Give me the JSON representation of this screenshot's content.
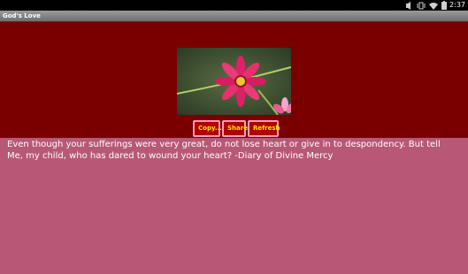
{
  "status_bar": {
    "time": "2:37",
    "icons": [
      "media-icon",
      "vibrate-icon",
      "wifi-icon",
      "battery-icon"
    ]
  },
  "app": {
    "title": "God's Love"
  },
  "buttons": {
    "copy_label": "Copy...",
    "share_label": "Share",
    "refresh_label": "Refresh"
  },
  "content": {
    "quote": "Even though your sufferings were very great, do not lose heart or give in to despondency. But tell Me, my child, who has dared to wound your heart? -Diary of Divine Mercy"
  },
  "colors": {
    "header_bg": "#7a0000",
    "content_bg": "#b85876",
    "button_bg": "#b00000",
    "button_border": "#ff9cb8",
    "button_text": "#ffe600"
  }
}
